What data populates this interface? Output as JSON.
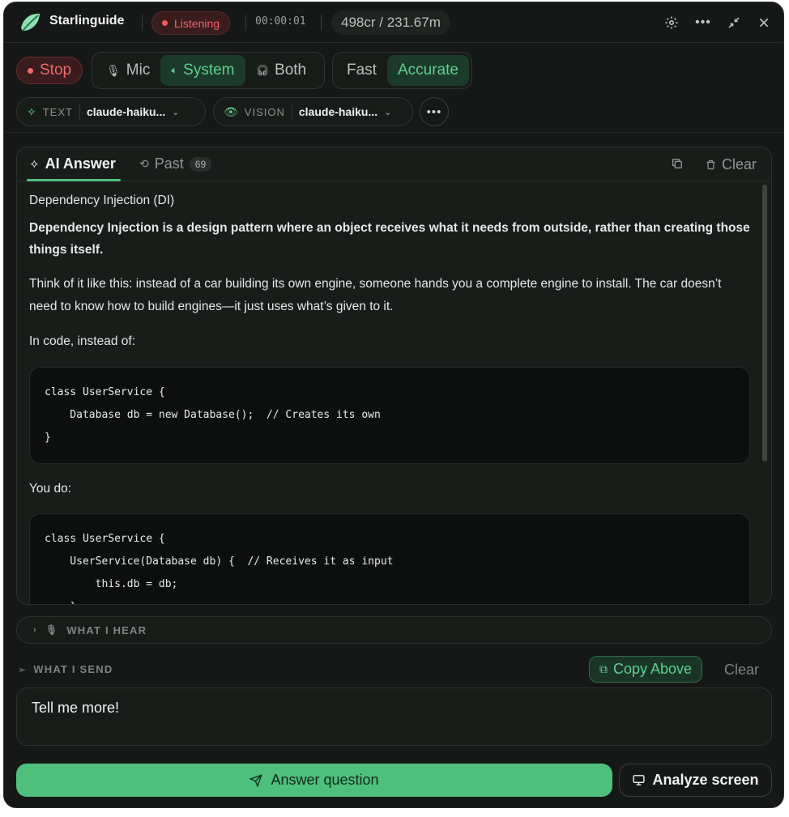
{
  "app": {
    "name": "Starlinguide",
    "status": "Listening",
    "timer": "00:00:01",
    "credits": "498cr / 231.67m",
    "accent_color": "#4fbf7e",
    "danger_color": "#ef5a5a"
  },
  "titlebar_icons": [
    "gear-icon",
    "more-icon",
    "collapse-icon",
    "close-icon"
  ],
  "controls": {
    "stop_label": "Stop",
    "source": {
      "options": [
        "Mic",
        "System",
        "Both"
      ],
      "selected": "System"
    },
    "mode": {
      "options": [
        "Fast",
        "Accurate"
      ],
      "selected": "Accurate"
    },
    "text_model": {
      "label": "TEXT",
      "value": "claude-haiku..."
    },
    "vision_model": {
      "label": "VISION",
      "value": "claude-haiku..."
    }
  },
  "answer_panel": {
    "tab_ai": "AI Answer",
    "tab_past": "Past",
    "past_count": "69",
    "clear_label": "Clear",
    "heading": "Dependency Injection (DI)",
    "bold_intro": "Dependency Injection is a design pattern where an object receives what it needs from outside, rather than creating those things itself.",
    "paragraph": "Think of it like this: instead of a car building its own engine, someone hands you a complete engine to install. The car doesn’t need to know how to build engines—it just uses what’s given to it.",
    "instead_label": "In code, instead of:",
    "code_before": "class UserService {\n    Database db = new Database();  // Creates its own\n}",
    "you_do_label": "You do:",
    "code_after": "class UserService {\n    UserService(Database db) {  // Receives it as input\n        this.db = db;\n    }\n}"
  },
  "hear": {
    "label": "WHAT I HEAR"
  },
  "send": {
    "label": "WHAT I SEND",
    "copy_above": "Copy Above",
    "clear": "Clear",
    "text": "Tell me more!"
  },
  "actions": {
    "answer": "Answer question",
    "analyze": "Analyze screen"
  }
}
